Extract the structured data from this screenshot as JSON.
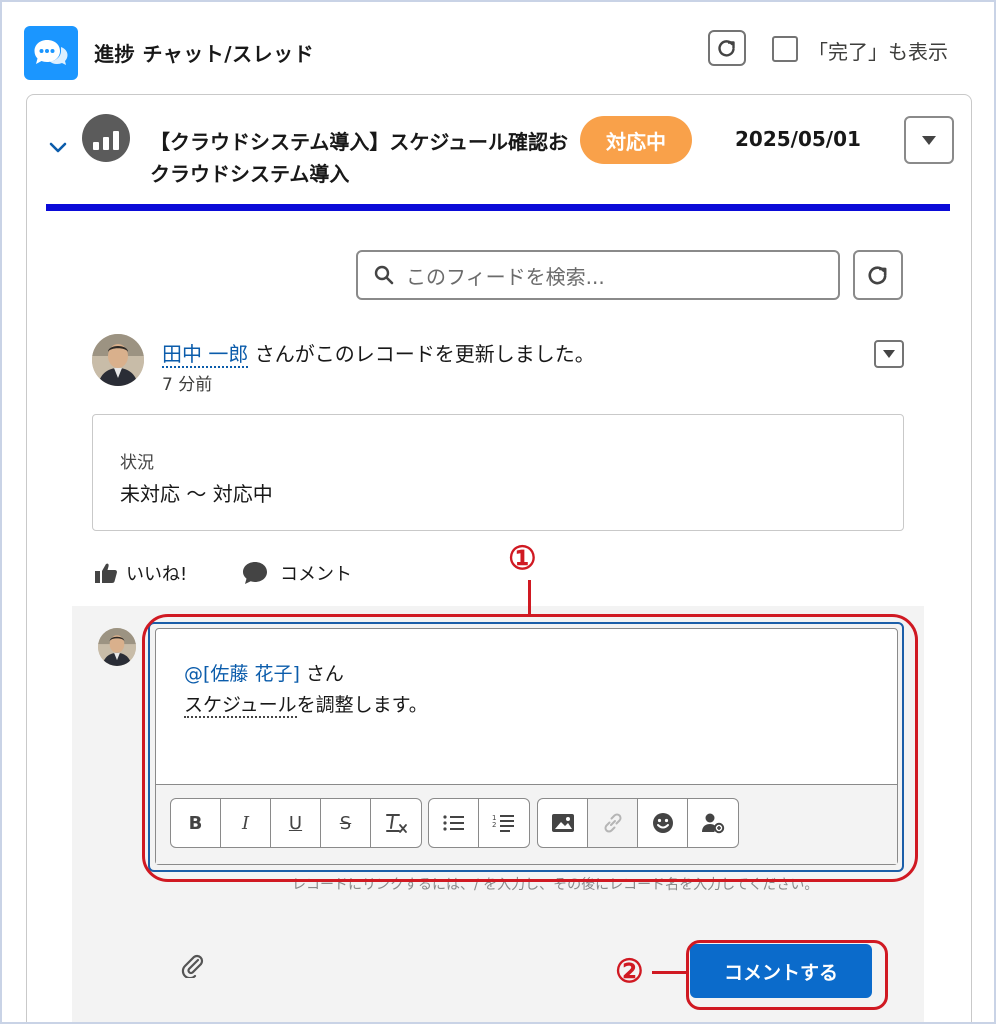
{
  "header": {
    "title": "進捗 チャット/スレッド",
    "show_completed_label": "「完了」も表示"
  },
  "record": {
    "title": "【クラウドシステム導入】スケジュール確認お",
    "subtitle": "クラウドシステム導入",
    "status": "対応中",
    "date": "2025/05/01"
  },
  "search": {
    "placeholder": "このフィードを検索..."
  },
  "post": {
    "author": "田中 一郎",
    "action": " さんがこのレコードを更新しました。",
    "time": "7 分前",
    "change_label": "状況",
    "change_value": "未対応 〜 対応中",
    "like_label": "いいね!",
    "comment_label": "コメント"
  },
  "comment": {
    "mention": "@[佐藤 花子]",
    "mention_suffix": " さん",
    "line2_underlined": "スケジュール",
    "line2_rest": "を調整します。",
    "toolbar": {
      "bold": "B",
      "italic": "I",
      "underline": "U",
      "strike": "S"
    },
    "hint": "レコードにリンクするには、/ を入力し、その後にレコード名を入力してください。",
    "submit_label": "コメントする"
  },
  "annotations": {
    "step1": "①",
    "step2": "②"
  },
  "colors": {
    "accent": "#0b6bcb",
    "status_badge": "#f9a14a",
    "annotation": "#d01922",
    "divider": "#0b0bd8"
  }
}
